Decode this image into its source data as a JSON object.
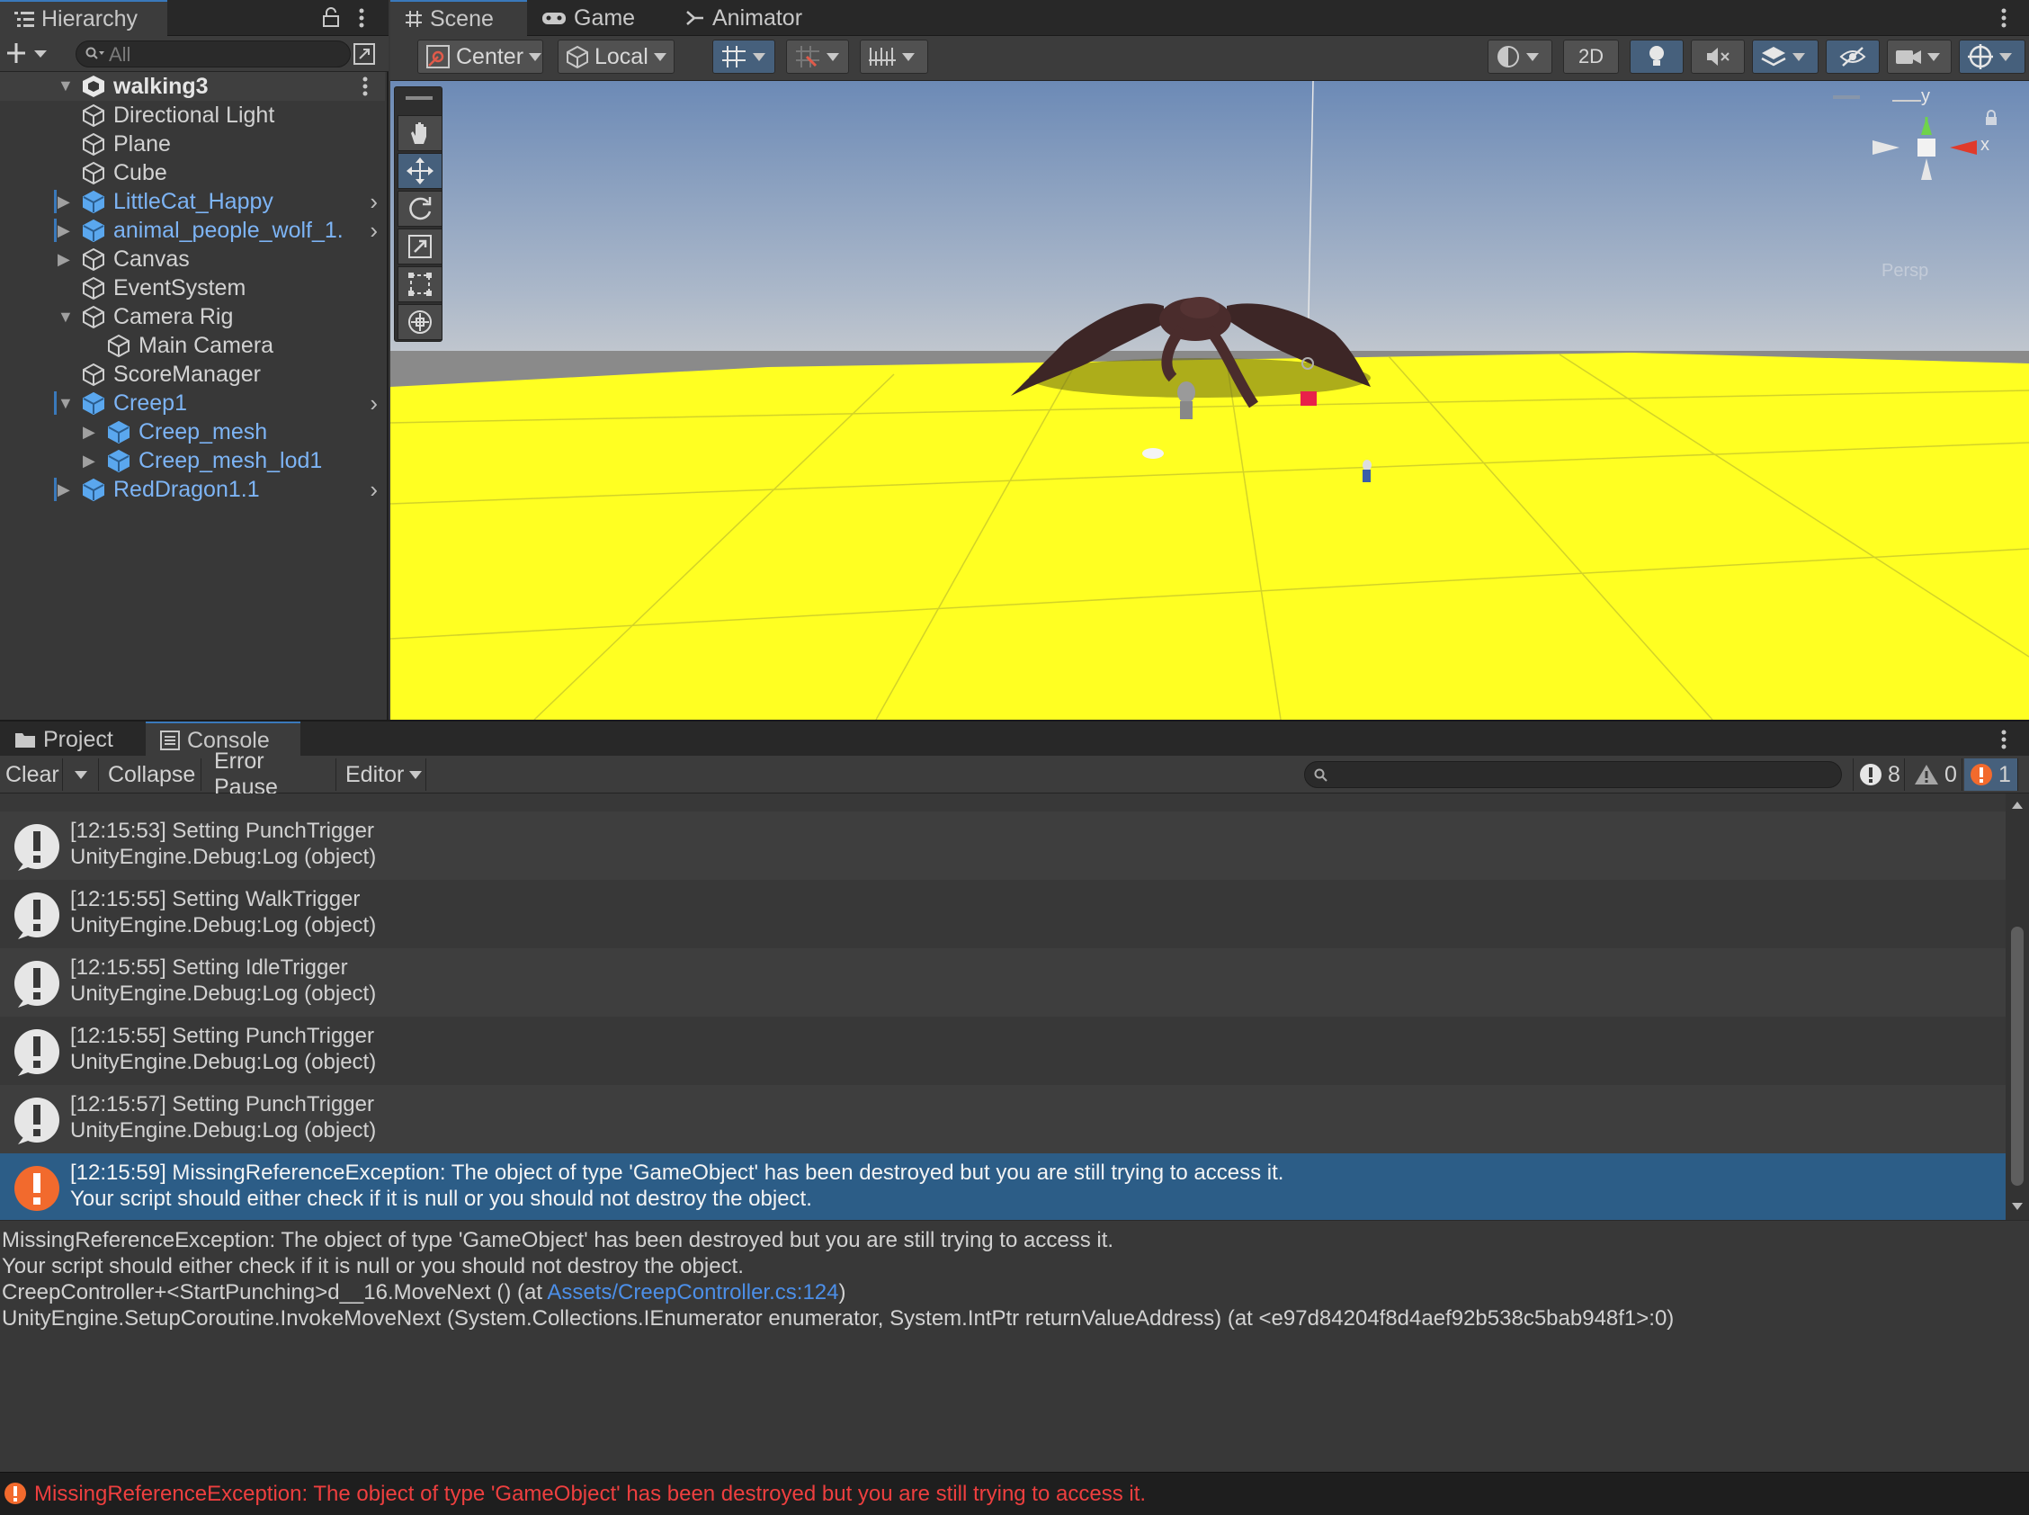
{
  "hierarchy": {
    "tab_label": "Hierarchy",
    "search_placeholder": "All",
    "scene_name": "walking3",
    "items": [
      {
        "label": "Directional Light"
      },
      {
        "label": "Plane"
      },
      {
        "label": "Cube"
      },
      {
        "label": "LittleCat_Happy"
      },
      {
        "label": "animal_people_wolf_1."
      },
      {
        "label": "Canvas"
      },
      {
        "label": "EventSystem"
      },
      {
        "label": "Camera Rig"
      },
      {
        "label": "Main Camera"
      },
      {
        "label": "ScoreManager"
      },
      {
        "label": "Creep1"
      },
      {
        "label": "Creep_mesh"
      },
      {
        "label": "Creep_mesh_lod1"
      },
      {
        "label": "RedDragon1.1"
      }
    ]
  },
  "scene_tabs": {
    "scene": "Scene",
    "game": "Game",
    "animator": "Animator"
  },
  "scene_toolbar": {
    "pivot": "Center",
    "space": "Local",
    "mode_2d": "2D"
  },
  "gizmo": {
    "y": "y",
    "x": "x",
    "persp": "Persp"
  },
  "colors": {
    "ground": "#ffff22",
    "sky_top": "#6f8db7",
    "selection": "#2c5d87",
    "prefab_text": "#7db4f5",
    "error": "#ee3f3f",
    "error_icon": "#f26a2d"
  },
  "bottom_tabs": {
    "project": "Project",
    "console": "Console"
  },
  "console": {
    "clear": "Clear",
    "collapse": "Collapse",
    "error_pause": "Error Pause",
    "editor": "Editor",
    "count_log": "8",
    "count_warn": "0",
    "count_error": "1",
    "logs": [
      {
        "line1": "[12:15:53] Setting PunchTrigger",
        "line2": "UnityEngine.Debug:Log (object)"
      },
      {
        "line1": "[12:15:55] Setting WalkTrigger",
        "line2": "UnityEngine.Debug:Log (object)"
      },
      {
        "line1": "[12:15:55] Setting IdleTrigger",
        "line2": "UnityEngine.Debug:Log (object)"
      },
      {
        "line1": "[12:15:55] Setting PunchTrigger",
        "line2": "UnityEngine.Debug:Log (object)"
      },
      {
        "line1": "[12:15:57] Setting PunchTrigger",
        "line2": "UnityEngine.Debug:Log (object)"
      },
      {
        "line1": "[12:15:59] MissingReferenceException: The object of type 'GameObject' has been destroyed but you are still trying to access it.",
        "line2": "Your script should either check if it is null or you should not destroy the object."
      }
    ],
    "detail": {
      "line1": "MissingReferenceException: The object of type 'GameObject' has been destroyed but you are still trying to access it.",
      "line2": "Your script should either check if it is null or you should not destroy the object.",
      "line3_pre": "CreepController+<StartPunching>d__16.MoveNext () (at ",
      "line3_link": "Assets/CreepController.cs:124",
      "line3_post": ")",
      "line4": "UnityEngine.SetupCoroutine.InvokeMoveNext (System.Collections.IEnumerator enumerator, System.IntPtr returnValueAddress) (at <e97d84204f8d4aef92b538c5bab948f1>:0)"
    }
  },
  "status_bar": {
    "message": "MissingReferenceException: The object of type 'GameObject' has been destroyed but you are still trying to access it."
  }
}
